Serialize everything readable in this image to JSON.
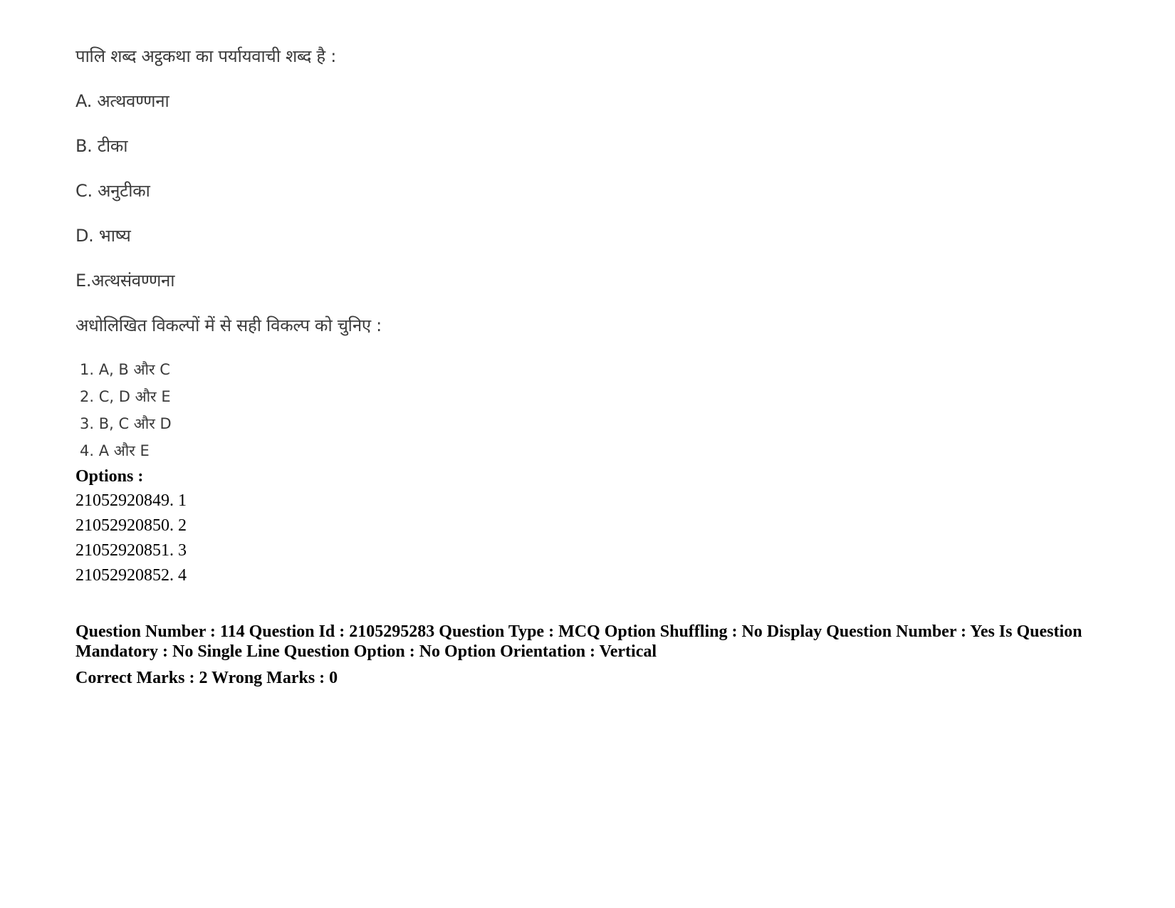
{
  "question": {
    "stem": "पालि शब्द अट्ठकथा का पर्यायवाची शब्द है :",
    "statements": [
      {
        "label": "A.",
        "text": " अत्थवण्णना"
      },
      {
        "label": "B.",
        "text": " टीका"
      },
      {
        "label": "C.",
        "text": " अनुटीका"
      },
      {
        "label": "D.",
        "text": " भाष्य"
      },
      {
        "label": "E.",
        "text": "अत्थसंवण्णना"
      }
    ],
    "instruction": "अधोलिखित विकल्पों में से सही विकल्प को चुनिए :",
    "choices": [
      "1. A, B और C",
      "2. C, D और  E",
      "3. B, C और D",
      "4. A और E"
    ]
  },
  "options": {
    "heading": "Options :",
    "items": [
      "21052920849. 1",
      "21052920850. 2",
      "21052920851. 3",
      "21052920852. 4"
    ]
  },
  "metadata": {
    "details": "Question Number : 114 Question Id : 2105295283 Question Type : MCQ Option Shuffling : No Display Question Number : Yes Is Question Mandatory : No Single Line Question Option : No Option Orientation : Vertical",
    "marks": "Correct Marks : 2 Wrong Marks : 0"
  }
}
